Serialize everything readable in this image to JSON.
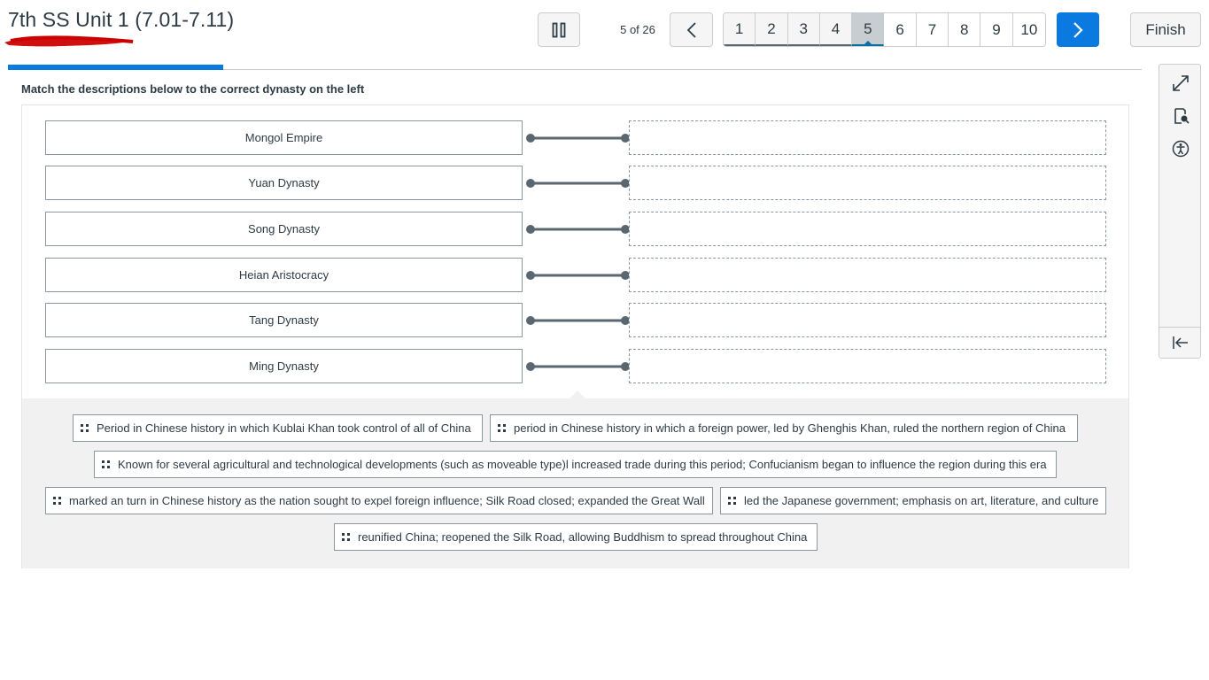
{
  "header": {
    "title": "7th SS Unit 1 (7.01-7.11)",
    "counter": "5 of 26",
    "finish_label": "Finish"
  },
  "pager": {
    "pages": [
      "1",
      "2",
      "3",
      "4",
      "5",
      "6",
      "7",
      "8",
      "9",
      "10"
    ],
    "current": "5"
  },
  "progress": {
    "fraction": 0.19
  },
  "question": {
    "prompt": "Match the descriptions below to the correct dynasty on the left",
    "terms": [
      "Mongol Empire",
      "Yuan Dynasty",
      "Song Dynasty",
      "Heian Aristocracy",
      "Tang Dynasty",
      "Ming Dynasty"
    ],
    "answer_bank": [
      "Period in Chinese history in which Kublai Khan took control of all of China",
      "period in Chinese history in which a foreign power, led by Ghenghis Khan, ruled the northern region of China",
      "Known for several agricultural and technological developments (such as moveable type)l increased trade during this period; Confucianism began to influence the region during this era",
      "marked an turn in Chinese history as the nation sought to expel foreign influence; Silk Road closed; expanded the Great Wall",
      "led the Japanese government; emphasis on art, literature, and culture",
      "reunified China; reopened the Silk Road, allowing Buddhism to spread throughout China"
    ]
  },
  "icons": {
    "pause": "pause-icon",
    "prev": "chevron-left-icon",
    "next": "chevron-right-icon",
    "expand": "expand-icon",
    "calculator": "document-search-icon",
    "accessibility": "accessibility-icon",
    "collapse": "collapse-panel-icon",
    "grip": "drag-handle-icon"
  },
  "colors": {
    "accent": "#0b7ae0",
    "border": "#c7cdd1",
    "text": "#2d3b45",
    "redaction": "#d01010"
  }
}
